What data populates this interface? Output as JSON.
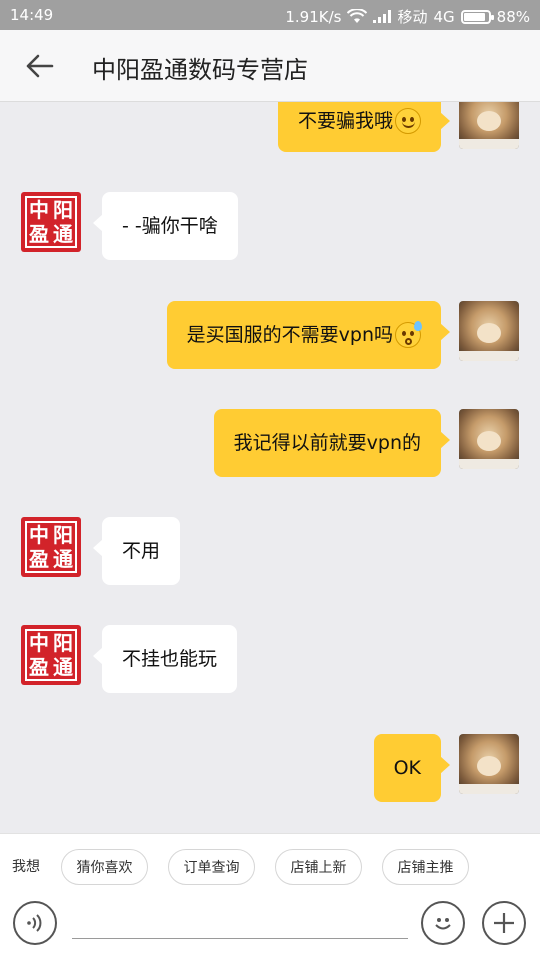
{
  "status_bar": {
    "time": "14:49",
    "net_speed": "1.91K/s",
    "carrier": "移动",
    "network": "4G",
    "battery": "88%",
    "battery_level": 0.88
  },
  "header": {
    "back_icon": "arrow-left-icon",
    "title": "中阳盈通数码专营店"
  },
  "shop_avatar": {
    "chars": [
      "盈",
      "中",
      "通",
      "阳"
    ],
    "color": "#d2232a"
  },
  "messages": [
    {
      "side": "right",
      "text": "不要骗我哦",
      "emoji": "smile-emoji"
    },
    {
      "side": "left",
      "text": "- -骗你干啥"
    },
    {
      "side": "right",
      "text": "是买国服的不需要vpn吗",
      "emoji": "sweat-emoji"
    },
    {
      "side": "right",
      "text": "我记得以前就要vpn的"
    },
    {
      "side": "left",
      "text": "不用"
    },
    {
      "side": "left",
      "text": "不挂也能玩"
    },
    {
      "side": "right",
      "text": "OK"
    }
  ],
  "quick_bar": {
    "label": "我想",
    "chips": [
      "猜你喜欢",
      "订单查询",
      "店铺上新",
      "店铺主推"
    ]
  },
  "input_bar": {
    "voice_icon": "voice-icon",
    "placeholder": "",
    "emoji_icon": "emoji-icon",
    "add_icon": "plus-icon"
  },
  "colors": {
    "own_bubble": "#ffcc33",
    "other_bubble": "#ffffff",
    "chat_background": "#ececef"
  }
}
